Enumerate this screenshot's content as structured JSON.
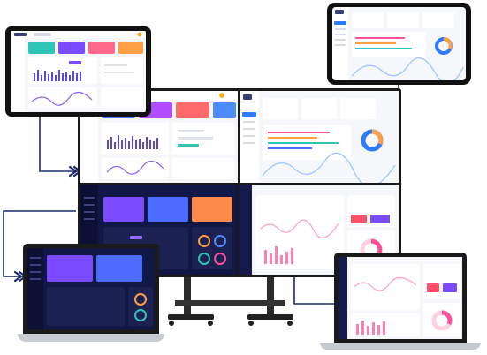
{
  "colors": {
    "navy": "#0f1440",
    "navy_panel": "#1b2150",
    "connector": "#1a2a6c",
    "purple": "#6b4bff",
    "pink": "#ff5aa0",
    "orange": "#ff8a4c",
    "blue": "#4c8cff",
    "teal": "#2ec4b6",
    "donut_blue": "#2f7bff",
    "donut_orange": "#ff9f43",
    "donut_pink": "#ff4f9a"
  },
  "devices": {
    "tablet": {
      "kind": "tablet",
      "theme": "light"
    },
    "phone": {
      "kind": "phone",
      "theme": "light"
    },
    "video_wall": {
      "kind": "monitor",
      "quadrants": [
        "light-dashboard",
        "light-analytics",
        "dark-dashboard",
        "light-sales"
      ]
    },
    "laptop_left": {
      "kind": "laptop",
      "theme": "dark"
    },
    "laptop_right": {
      "kind": "laptop",
      "theme": "light"
    }
  },
  "icons": [
    "arrow-double-chevron-icon"
  ]
}
